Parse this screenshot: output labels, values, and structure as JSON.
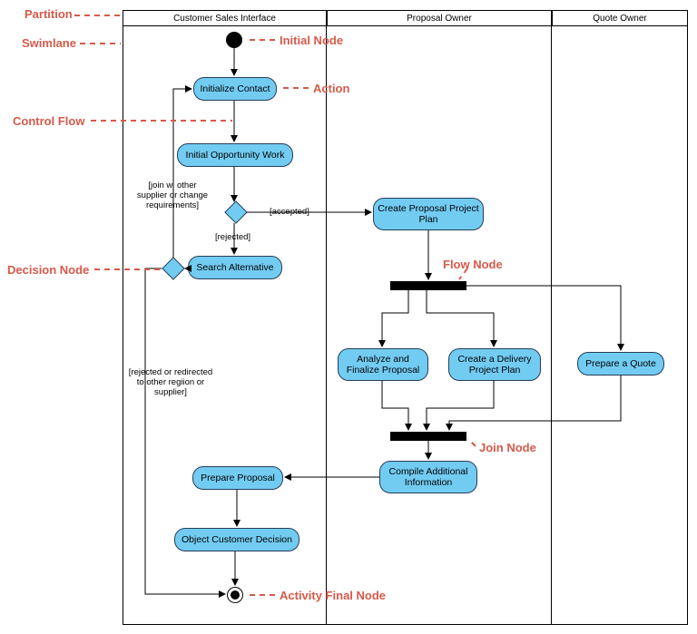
{
  "lanes": {
    "l1": "Customer Sales Interface",
    "l2": "Proposal Owner",
    "l3": "Quote Owner"
  },
  "actions": {
    "initContact": "Initialize Contact",
    "initOpp": "Initial Opportunity Work",
    "searchAlt": "Search Alternative",
    "createPlan": "Create Proposal Project Plan",
    "analyze": "Analyze and Finalize Proposal",
    "delivery": "Create a Delivery Project Plan",
    "quote": "Prepare a Quote",
    "compile": "Compile Additional Information",
    "prepProp": "Prepare Proposal",
    "objDec": "Object Customer Decision"
  },
  "guards": {
    "accepted": "[accepted]",
    "rejected": "[rejected]",
    "joinOther": "[join w. other supplier or change requirements]",
    "rejRedir": "[rejected or redirected to other regiion or supplier]"
  },
  "callouts": {
    "partition": "Partition",
    "swimlane": "Swimlane",
    "initialNode": "Initial Node",
    "action": "Action",
    "controlFlow": "Control Flow",
    "decisionNode": "Decision Node",
    "flowNode": "Flow Node",
    "joinNode": "Join Node",
    "finalNode": "Activity Final Node"
  },
  "chart_data": {
    "type": "uml-activity-diagram",
    "partitions": [
      {
        "id": "L1",
        "name": "Customer Sales Interface"
      },
      {
        "id": "L2",
        "name": "Proposal Owner"
      },
      {
        "id": "L3",
        "name": "Quote Owner"
      }
    ],
    "nodes": [
      {
        "id": "start",
        "kind": "initial",
        "lane": "L1"
      },
      {
        "id": "initContact",
        "kind": "action",
        "lane": "L1",
        "label": "Initialize Contact"
      },
      {
        "id": "initOpp",
        "kind": "action",
        "lane": "L1",
        "label": "Initial Opportunity Work"
      },
      {
        "id": "dec1",
        "kind": "decision",
        "lane": "L1"
      },
      {
        "id": "searchAlt",
        "kind": "action",
        "lane": "L1",
        "label": "Search Alternative"
      },
      {
        "id": "dec2",
        "kind": "decision",
        "lane": "L1"
      },
      {
        "id": "createPlan",
        "kind": "action",
        "lane": "L2",
        "label": "Create Proposal Project Plan"
      },
      {
        "id": "fork",
        "kind": "fork",
        "lane": "L2"
      },
      {
        "id": "analyze",
        "kind": "action",
        "lane": "L2",
        "label": "Analyze and Finalize Proposal"
      },
      {
        "id": "delivery",
        "kind": "action",
        "lane": "L2",
        "label": "Create a Delivery Project Plan"
      },
      {
        "id": "quote",
        "kind": "action",
        "lane": "L3",
        "label": "Prepare a Quote"
      },
      {
        "id": "join",
        "kind": "join",
        "lane": "L2"
      },
      {
        "id": "compile",
        "kind": "action",
        "lane": "L2",
        "label": "Compile Additional Information"
      },
      {
        "id": "prepProp",
        "kind": "action",
        "lane": "L1",
        "label": "Prepare Proposal"
      },
      {
        "id": "objDec",
        "kind": "action",
        "lane": "L1",
        "label": "Object Customer Decision"
      },
      {
        "id": "end",
        "kind": "final",
        "lane": "L1"
      }
    ],
    "edges": [
      {
        "from": "start",
        "to": "initContact"
      },
      {
        "from": "initContact",
        "to": "initOpp"
      },
      {
        "from": "initOpp",
        "to": "dec1"
      },
      {
        "from": "dec1",
        "to": "createPlan",
        "guard": "[accepted]"
      },
      {
        "from": "dec1",
        "to": "searchAlt",
        "guard": "[rejected]"
      },
      {
        "from": "searchAlt",
        "to": "dec2"
      },
      {
        "from": "dec2",
        "to": "initContact",
        "guard": "[join w. other supplier or change requirements]"
      },
      {
        "from": "dec2",
        "to": "end",
        "guard": "[rejected or redirected to other regiion or supplier]"
      },
      {
        "from": "createPlan",
        "to": "fork"
      },
      {
        "from": "fork",
        "to": "analyze"
      },
      {
        "from": "fork",
        "to": "delivery"
      },
      {
        "from": "fork",
        "to": "quote"
      },
      {
        "from": "analyze",
        "to": "join"
      },
      {
        "from": "delivery",
        "to": "join"
      },
      {
        "from": "quote",
        "to": "join"
      },
      {
        "from": "join",
        "to": "compile"
      },
      {
        "from": "compile",
        "to": "prepProp"
      },
      {
        "from": "prepProp",
        "to": "objDec"
      },
      {
        "from": "objDec",
        "to": "end"
      }
    ],
    "annotations": [
      {
        "label": "Partition",
        "points_to": "lane header"
      },
      {
        "label": "Swimlane",
        "points_to": "lane body border"
      },
      {
        "label": "Initial Node",
        "points_to": "start"
      },
      {
        "label": "Action",
        "points_to": "initContact"
      },
      {
        "label": "Control Flow",
        "points_to": "edge initContact→initOpp"
      },
      {
        "label": "Decision Node",
        "points_to": "dec2"
      },
      {
        "label": "Flow Node",
        "points_to": "fork"
      },
      {
        "label": "Join Node",
        "points_to": "join"
      },
      {
        "label": "Activity Final Node",
        "points_to": "end"
      }
    ]
  }
}
